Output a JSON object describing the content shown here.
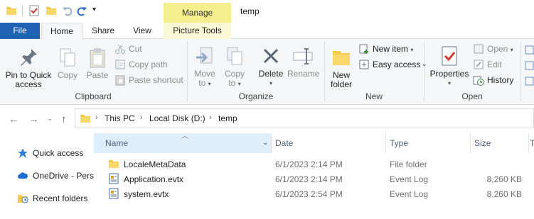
{
  "window": {
    "title": "temp",
    "contextual_tab_group": "Manage"
  },
  "tabs": {
    "file": "File",
    "home": "Home",
    "share": "Share",
    "view": "View",
    "picture_tools": "Picture Tools"
  },
  "ribbon": {
    "clipboard": {
      "label": "Clipboard",
      "pin_line1": "Pin to Quick",
      "pin_line2": "access",
      "copy": "Copy",
      "paste": "Paste",
      "cut": "Cut",
      "copy_path": "Copy path",
      "paste_shortcut": "Paste shortcut"
    },
    "organize": {
      "label": "Organize",
      "move_to": "Move",
      "move_to_2": "to",
      "copy_to": "Copy",
      "copy_to_2": "to",
      "delete": "Delete",
      "rename": "Rename"
    },
    "new": {
      "label": "New",
      "new_folder_1": "New",
      "new_folder_2": "folder",
      "new_item": "New item",
      "easy_access": "Easy access"
    },
    "open": {
      "label": "Open",
      "properties": "Properties",
      "open": "Open",
      "edit": "Edit",
      "history": "History"
    }
  },
  "address": {
    "crumbs": [
      "This PC",
      "Local Disk (D:)",
      "temp"
    ]
  },
  "nav_pane": {
    "items": [
      "Quick access",
      "OneDrive - Pers",
      "Recent folders"
    ]
  },
  "columns": {
    "name": "Name",
    "date": "Date",
    "type": "Type",
    "size": "Size",
    "extra": "T"
  },
  "files": [
    {
      "name": "LocaleMetaData",
      "date": "6/1/2023 2:14 PM",
      "type": "File folder",
      "size": "",
      "icon": "folder-icon"
    },
    {
      "name": "Application.evtx",
      "date": "6/1/2023 2:14 PM",
      "type": "Event Log",
      "size": "8,260 KB",
      "icon": "event-log-icon"
    },
    {
      "name": "system.evtx",
      "date": "6/1/2023 2:54 PM",
      "type": "Event Log",
      "size": "8,260 KB",
      "icon": "event-log-icon"
    }
  ],
  "colors": {
    "file_tab": "#1f62b4",
    "manage_tab": "#f5ee8f",
    "selected_header": "#dfeefb",
    "folder": "#f4c84a"
  }
}
